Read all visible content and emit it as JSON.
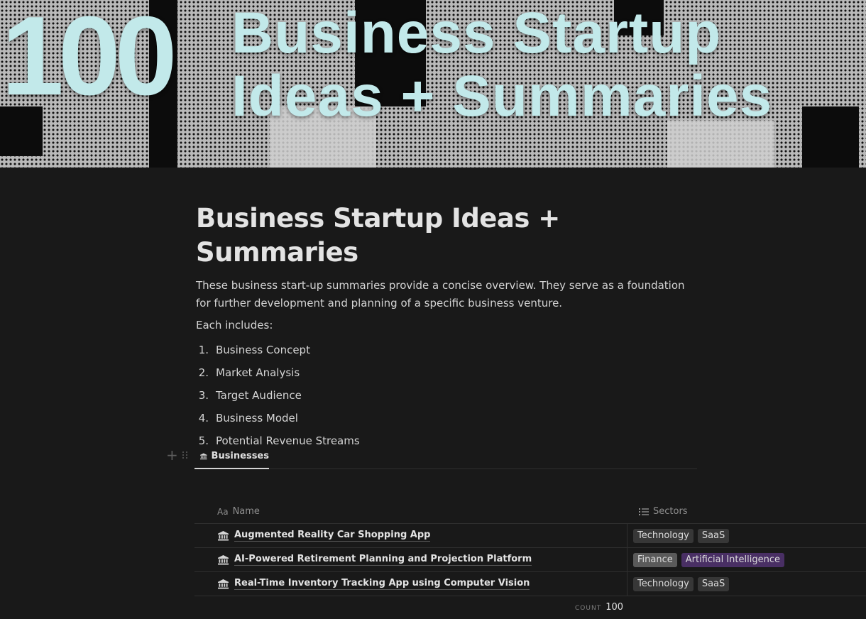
{
  "cover": {
    "number": "100",
    "line1": "Business Startup",
    "line2": "Ideas + Summaries",
    "text_color": "#c2e9ea"
  },
  "page": {
    "title": "Business Startup Ideas + Summaries",
    "intro": "These business start-up summaries provide a concise overview. They serve as a foundation for further development and planning of a specific business venture.",
    "includes_label": "Each includes:",
    "includes": [
      {
        "num": "1.",
        "text": "Business Concept"
      },
      {
        "num": "2.",
        "text": "Market Analysis"
      },
      {
        "num": "3.",
        "text": "Target Audience"
      },
      {
        "num": "4.",
        "text": "Business Model"
      },
      {
        "num": "5.",
        "text": "Potential Revenue Streams"
      }
    ]
  },
  "database": {
    "tab_label": "Businesses",
    "tab_icon": "bank-icon",
    "columns": {
      "name_prefix": "Aa",
      "name": "Name",
      "sectors": "Sectors"
    },
    "rows": [
      {
        "name": "Augmented Reality Car Shopping App",
        "tags": [
          {
            "label": "Technology",
            "color": "#373737"
          },
          {
            "label": "SaaS",
            "color": "#373737"
          }
        ]
      },
      {
        "name": "AI-Powered Retirement Planning and Projection Platform",
        "tags": [
          {
            "label": "Finance",
            "color": "#5a5a5a"
          },
          {
            "label": "Artificial Intelligence",
            "color": "#492f64"
          }
        ]
      },
      {
        "name": "Real-Time Inventory Tracking App using Computer Vision",
        "tags": [
          {
            "label": "Technology",
            "color": "#373737"
          },
          {
            "label": "SaaS",
            "color": "#373737"
          }
        ]
      }
    ],
    "count_label": "COUNT",
    "count_value": "100"
  }
}
